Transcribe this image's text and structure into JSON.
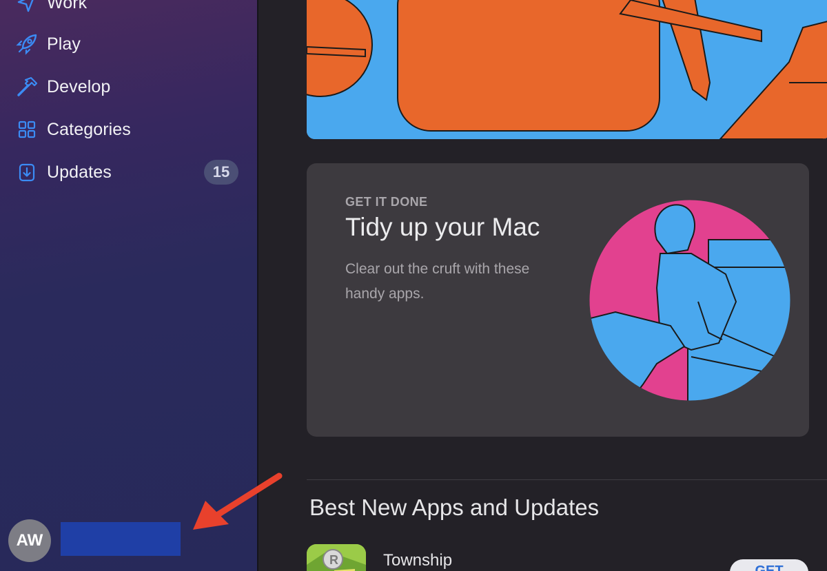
{
  "sidebar": {
    "items": [
      {
        "label": "Work",
        "icon": "paper-plane-icon"
      },
      {
        "label": "Play",
        "icon": "rocket-icon"
      },
      {
        "label": "Develop",
        "icon": "hammer-icon"
      },
      {
        "label": "Categories",
        "icon": "grid-icon"
      },
      {
        "label": "Updates",
        "icon": "download-icon",
        "badge": "15"
      }
    ],
    "account": {
      "initials": "AW"
    }
  },
  "feature_card": {
    "eyebrow": "GET IT DONE",
    "title": "Tidy up your Mac",
    "description": "Clear out the cruft with these handy apps."
  },
  "section": {
    "title": "Best New Apps and Updates",
    "apps": [
      {
        "name": "Township",
        "button": "GET"
      }
    ]
  },
  "colors": {
    "accent": "#3b8cf5",
    "annotation_arrow": "#e8412c",
    "hero_orange": "#e8672b",
    "hero_blue": "#4aa8ee",
    "art_pink": "#e2418f"
  }
}
